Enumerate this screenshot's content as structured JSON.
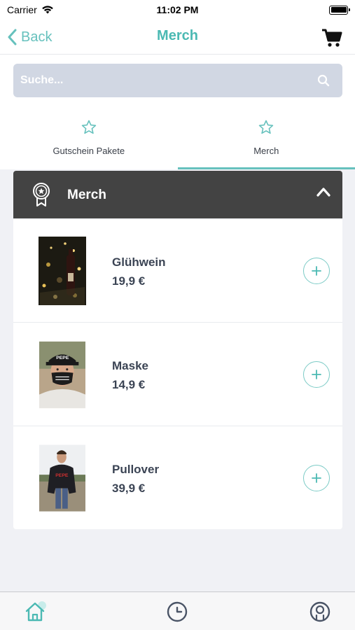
{
  "status_bar": {
    "carrier": "Carrier",
    "time": "11:02 PM"
  },
  "nav": {
    "back_label": "Back",
    "title": "Merch"
  },
  "search": {
    "placeholder": "Suche..."
  },
  "tabs": [
    {
      "label": "Gutschein Pakete",
      "active": false
    },
    {
      "label": "Merch",
      "active": true
    }
  ],
  "category": {
    "title": "Merch",
    "expanded": true
  },
  "products": [
    {
      "name": "Glühwein",
      "price": "19,9 €",
      "image": "mulled-wine-photo"
    },
    {
      "name": "Maske",
      "price": "14,9 €",
      "image": "face-mask-photo"
    },
    {
      "name": "Pullover",
      "price": "39,9 €",
      "image": "sweater-photo"
    }
  ],
  "tab_bar": {
    "items": [
      "home-icon",
      "clock-icon",
      "profile-icon"
    ]
  },
  "colors": {
    "accent": "#4bb9b3",
    "header_dark": "#434343",
    "search_bg": "#d1d7e3"
  }
}
